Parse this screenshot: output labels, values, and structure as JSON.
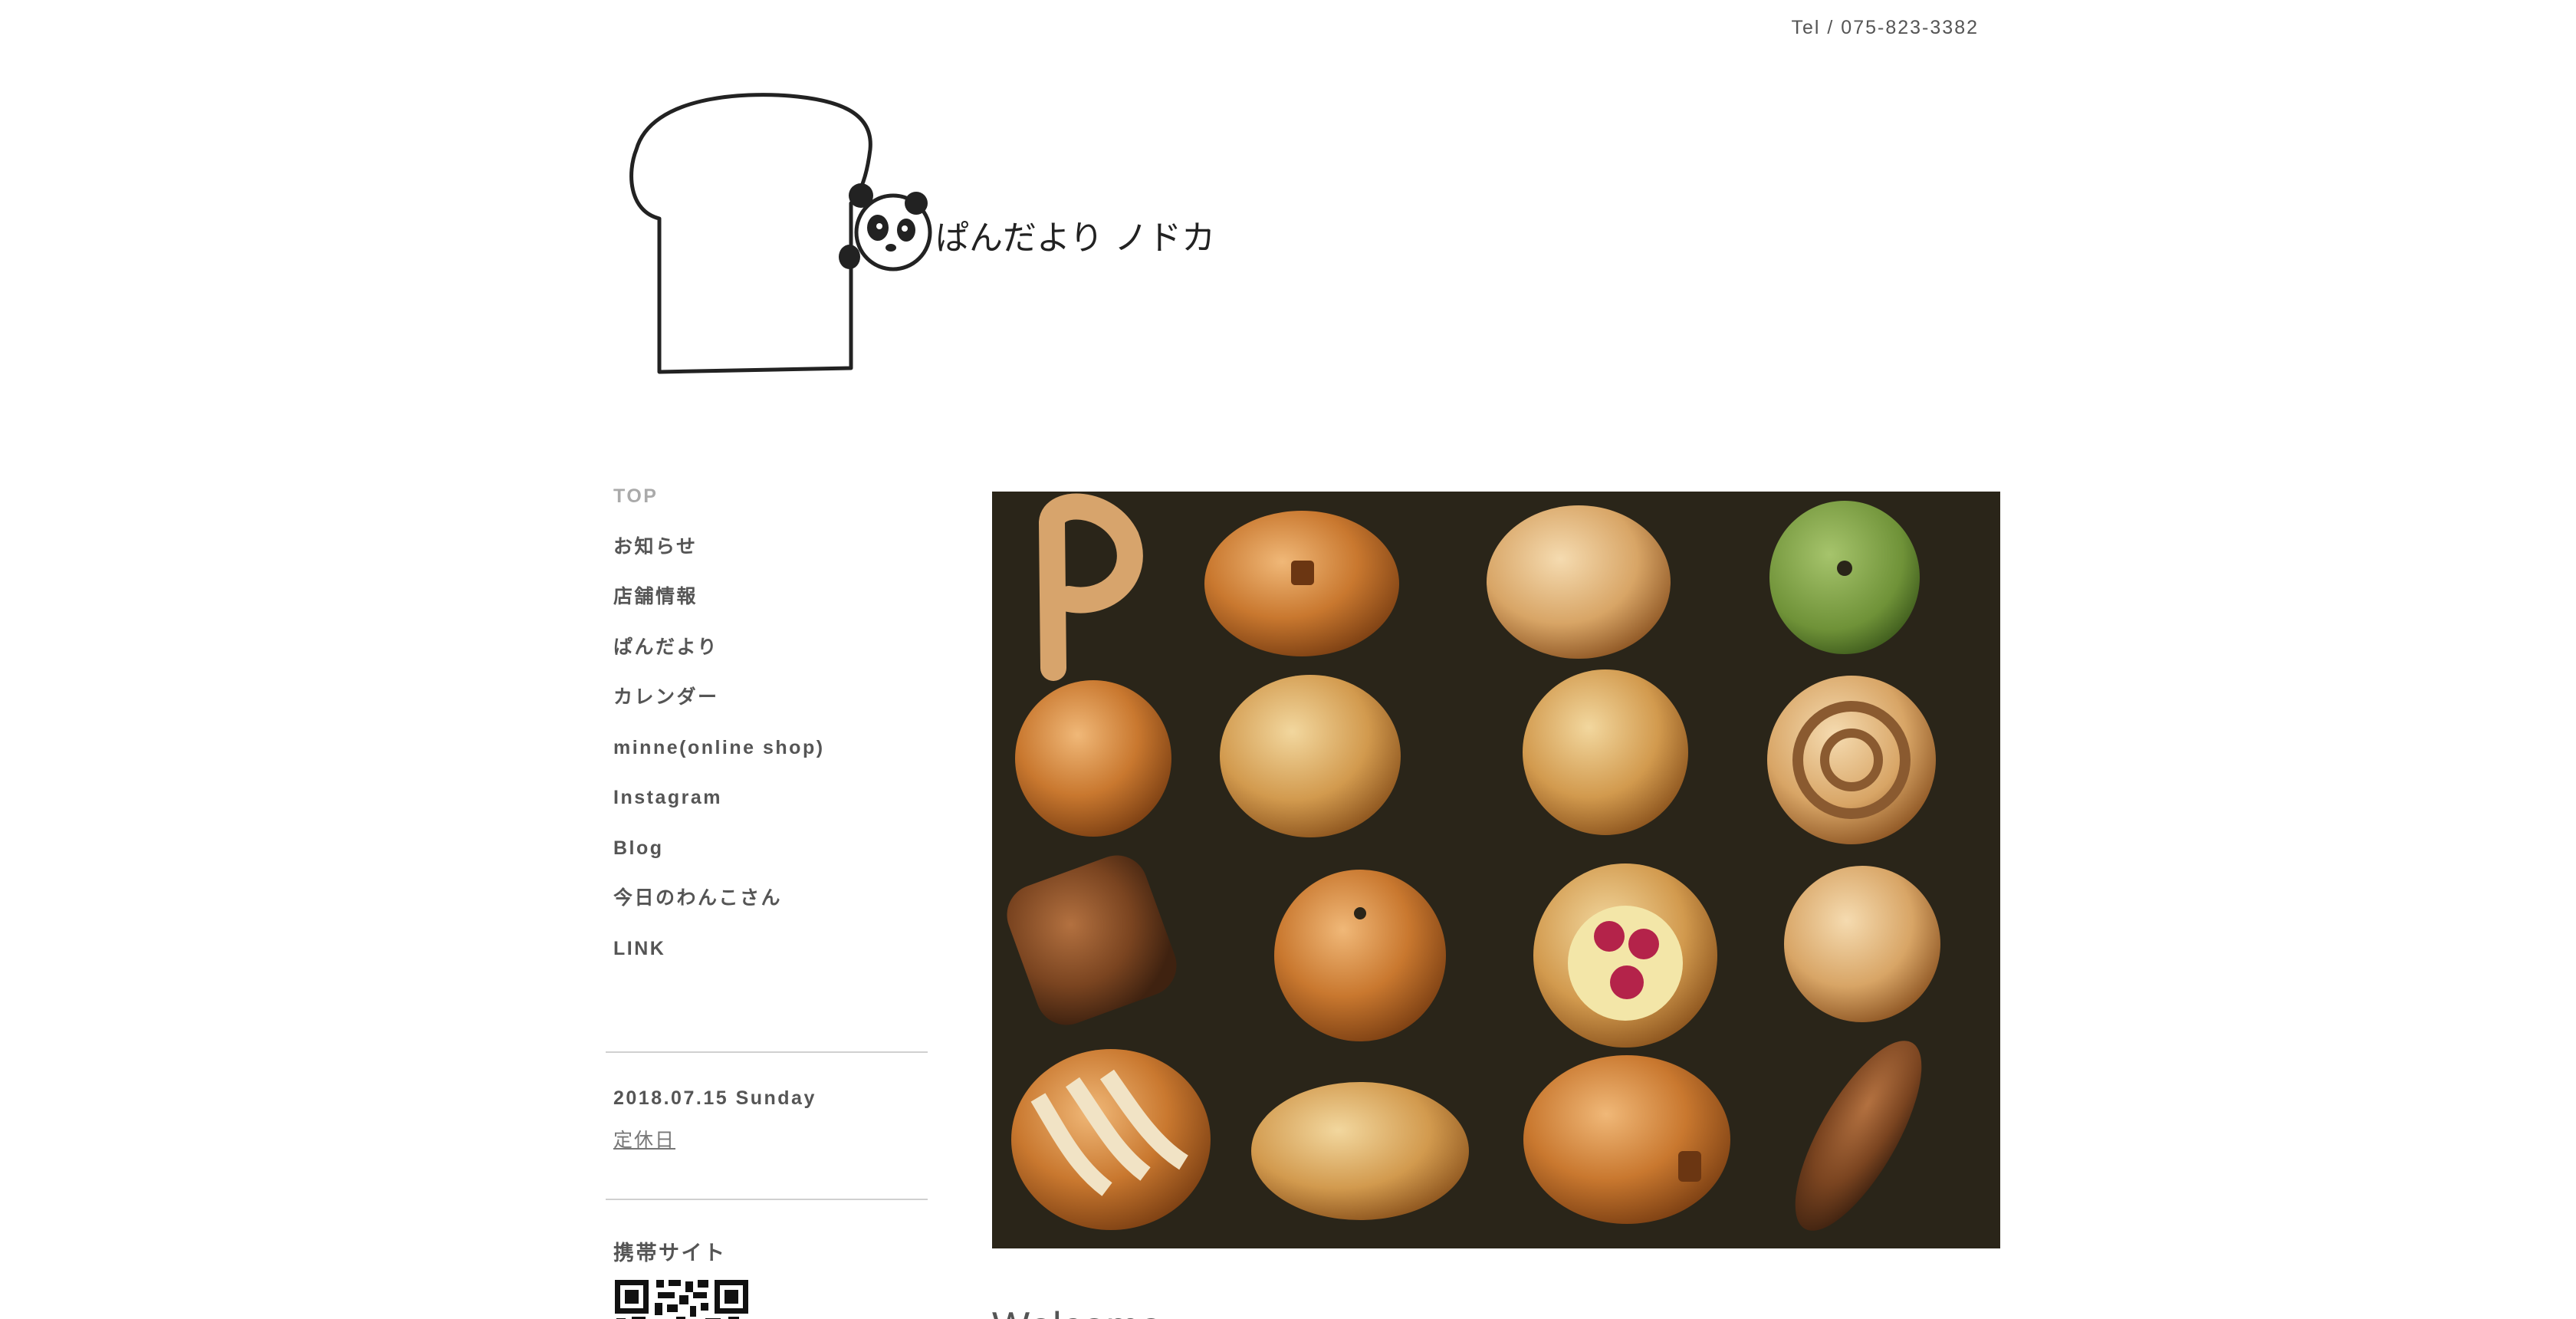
{
  "header": {
    "tel": "Tel / 075-823-3382",
    "logo_text": "ぱんだより ノドカ"
  },
  "nav": {
    "items": [
      {
        "label": "TOP",
        "current": true
      },
      {
        "label": "お知らせ"
      },
      {
        "label": "店舗情報"
      },
      {
        "label": "ぱんだより"
      },
      {
        "label": "カレンダー"
      },
      {
        "label": "minne(online shop)"
      },
      {
        "label": "Instagram"
      },
      {
        "label": "Blog"
      },
      {
        "label": "今日のわんこさん"
      },
      {
        "label": "LINK"
      }
    ]
  },
  "calendar": {
    "date": "2018.07.15 Sunday",
    "status": "定休日"
  },
  "mobile": {
    "title": "携帯サイト"
  },
  "main": {
    "welcome": "Welcome"
  }
}
